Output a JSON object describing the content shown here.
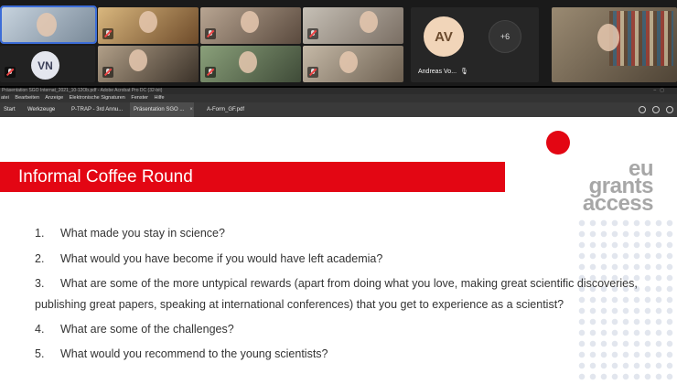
{
  "call": {
    "vn_initials": "VN",
    "av_initials": "AV",
    "av_name": "Andreas Vo...",
    "more_count": "+6"
  },
  "acrobat": {
    "title": "Präsentation SGO Internat_2021_10-12Ob.pdf - Adobe Acrobat Pro DC (32-bit)",
    "menu": [
      "atei",
      "Bearbeiten",
      "Anzeige",
      "Elektronische Signaturen",
      "Fenster",
      "Hilfe"
    ],
    "tabs": [
      "Start",
      "Werkzeuge",
      "P-TRAP - 3rd Annu...",
      "Präsentation SGO ...",
      "A-Form_GF.pdf"
    ]
  },
  "slide": {
    "title": "Informal Coffee Round",
    "logo_lines": [
      "eu",
      "grants",
      "access"
    ],
    "questions": [
      {
        "num": "1.",
        "text": "What made you stay in science?"
      },
      {
        "num": "2.",
        "text": "What would you have become if you would have left academia?"
      },
      {
        "num": "3.",
        "text": "What are some of the more untypical rewards (apart from doing what you love, making great scientific discoveries,",
        "cont": "publishing great papers, speaking at international conferences) that you get to experience as a scientist?"
      },
      {
        "num": "4.",
        "text": "What are some of the challenges?"
      },
      {
        "num": "5.",
        "text": "What would you recommend to the young scientists?"
      }
    ]
  },
  "colors": {
    "accent": "#e30613",
    "logo_gray": "#a7a7a7"
  }
}
